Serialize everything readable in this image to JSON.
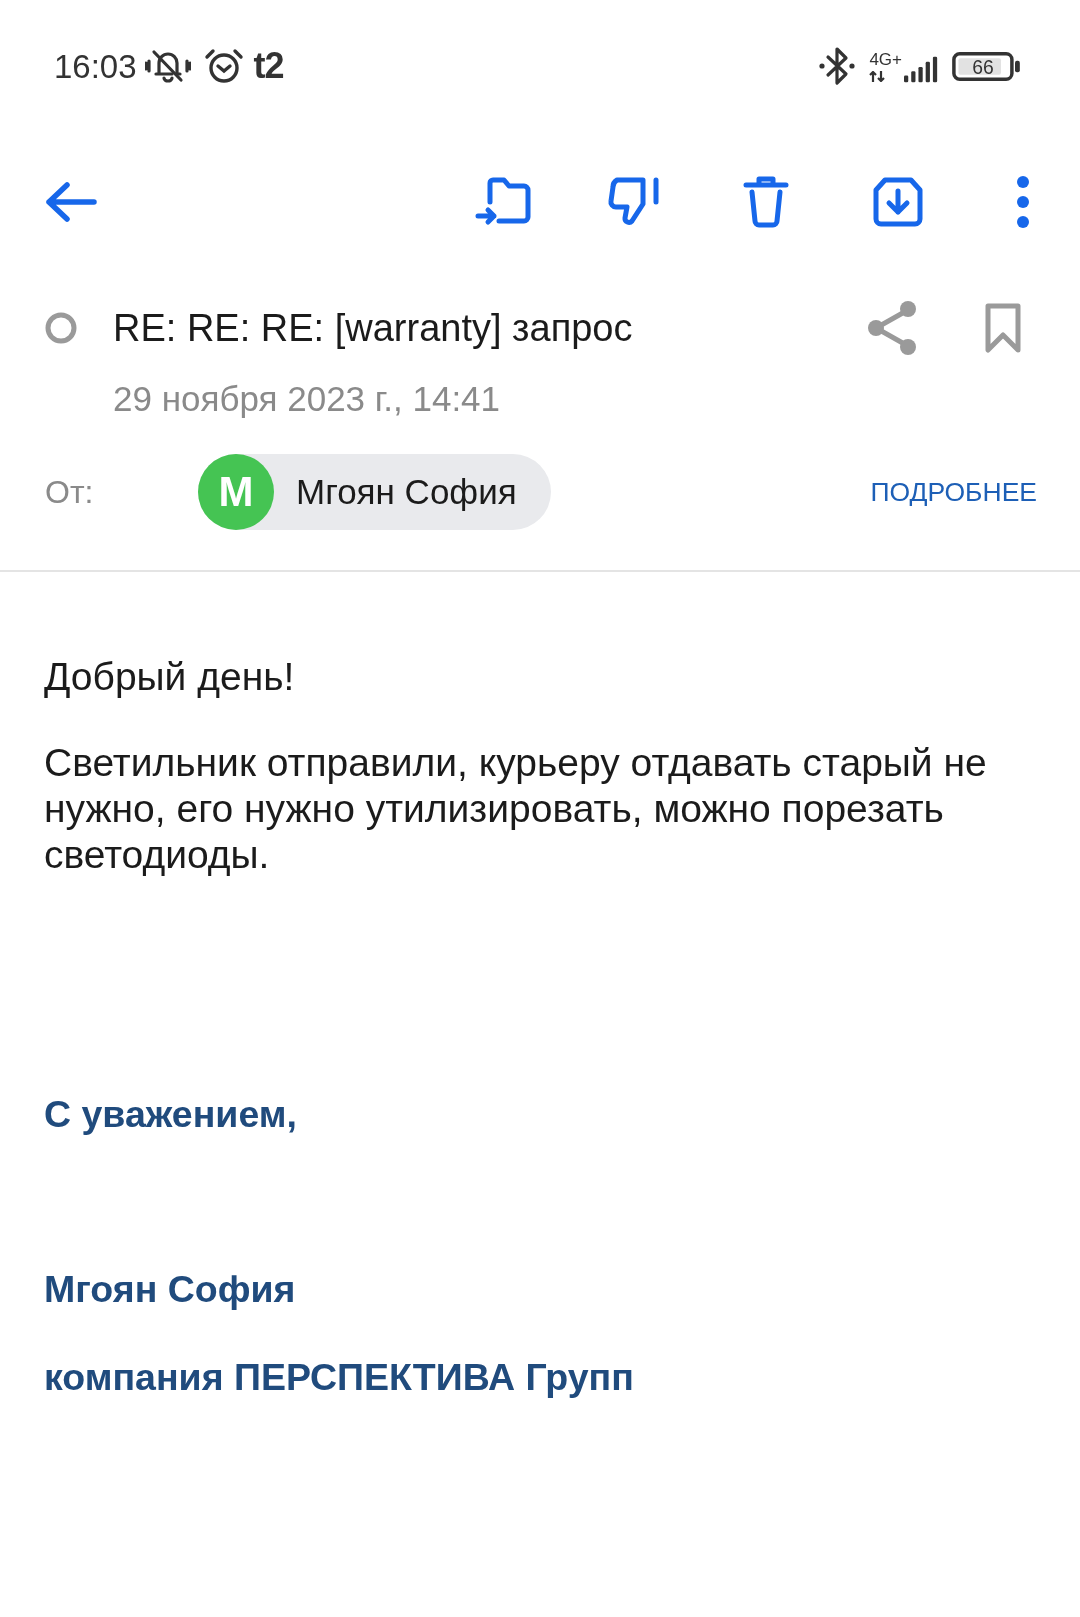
{
  "status_bar": {
    "time": "16:03",
    "carrier": "t2",
    "network": "4G+",
    "battery": "66"
  },
  "message": {
    "unread": false,
    "subject": "RE: RE: RE: [warranty] запрос",
    "bookmarked": false,
    "date": "29 ноября 2023 г., 14:41",
    "from_label": "От:",
    "sender": {
      "initial": "М",
      "name": "Мгоян София"
    },
    "details_link": "ПОДРОБНЕЕ"
  },
  "body": {
    "greeting": "Добрый день!",
    "paragraph": "Светильник отправили, курьеру отдавать старый не нужно, его нужно утилизировать, можно порезать светодиоды.",
    "signature": [
      "С уважением,",
      "Мгоян София",
      "компания ПЕРСПЕКТИВА Групп"
    ]
  }
}
